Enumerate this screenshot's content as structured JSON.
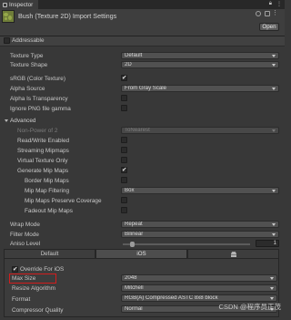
{
  "window": {
    "tab_title": "Inspector",
    "tab_icons": [
      "lock-icon",
      "kebab-icon"
    ],
    "title": "Bush (Texture 2D) Import Settings",
    "open_label": "Open",
    "header_icons": [
      "help-icon",
      "presets-icon",
      "kebab-icon"
    ],
    "accent": "#d21d1d"
  },
  "addressable": {
    "label": "Addressable",
    "checked": false
  },
  "settings": {
    "texture_type": {
      "label": "Texture Type",
      "value": "Default"
    },
    "texture_shape": {
      "label": "Texture Shape",
      "value": "2D"
    },
    "srgb": {
      "label": "sRGB (Color Texture)",
      "checked": true
    },
    "alpha_source": {
      "label": "Alpha Source",
      "value": "From Gray Scale"
    },
    "alpha_transparency": {
      "label": "Alpha Is Transparency",
      "checked": false
    },
    "ignore_png": {
      "label": "Ignore PNG file gamma",
      "checked": false
    }
  },
  "advanced": {
    "label": "Advanced",
    "non_power_of_2": {
      "label": "Non-Power of 2",
      "value": "ToNearest"
    },
    "read_write": {
      "label": "Read/Write Enabled",
      "checked": false
    },
    "streaming_mipmaps": {
      "label": "Streaming Mipmaps",
      "checked": false
    },
    "virtual_texture": {
      "label": "Virtual Texture Only",
      "checked": false
    },
    "generate_mipmaps": {
      "label": "Generate Mip Maps",
      "checked": true
    },
    "border_mipmaps": {
      "label": "Border Mip Maps",
      "checked": false
    },
    "mipmap_filtering": {
      "label": "Mip Map Filtering",
      "value": "Box"
    },
    "mipmap_coverage": {
      "label": "Mip Maps Preserve Coverage",
      "checked": false
    },
    "fadeout_mipmaps": {
      "label": "Fadeout Mip Maps",
      "checked": false
    }
  },
  "wrap_mode": {
    "label": "Wrap Mode",
    "value": "Repeat"
  },
  "filter_mode": {
    "label": "Filter Mode",
    "value": "Bilinear"
  },
  "aniso_level": {
    "label": "Aniso Level",
    "value": "1",
    "level": 0.0
  },
  "platform_tabs": [
    {
      "label": "Default",
      "active": false
    },
    {
      "label": "iOS",
      "active": true
    },
    {
      "label": "",
      "icon": "android-icon",
      "active": false
    }
  ],
  "platform": {
    "override": {
      "label": "Override For iOS",
      "checked": true
    },
    "max_size": {
      "label": "Max Size",
      "value": "2048"
    },
    "resize_algorithm": {
      "label": "Resize Algorithm",
      "value": "Mitchell"
    },
    "format": {
      "label": "Format",
      "value": "RGB(A) Compressed ASTC 8x8 block"
    },
    "compressor_quality": {
      "label": "Compressor Quality",
      "value": "Normal"
    }
  },
  "watermark": "CSDN @程序员正茂"
}
